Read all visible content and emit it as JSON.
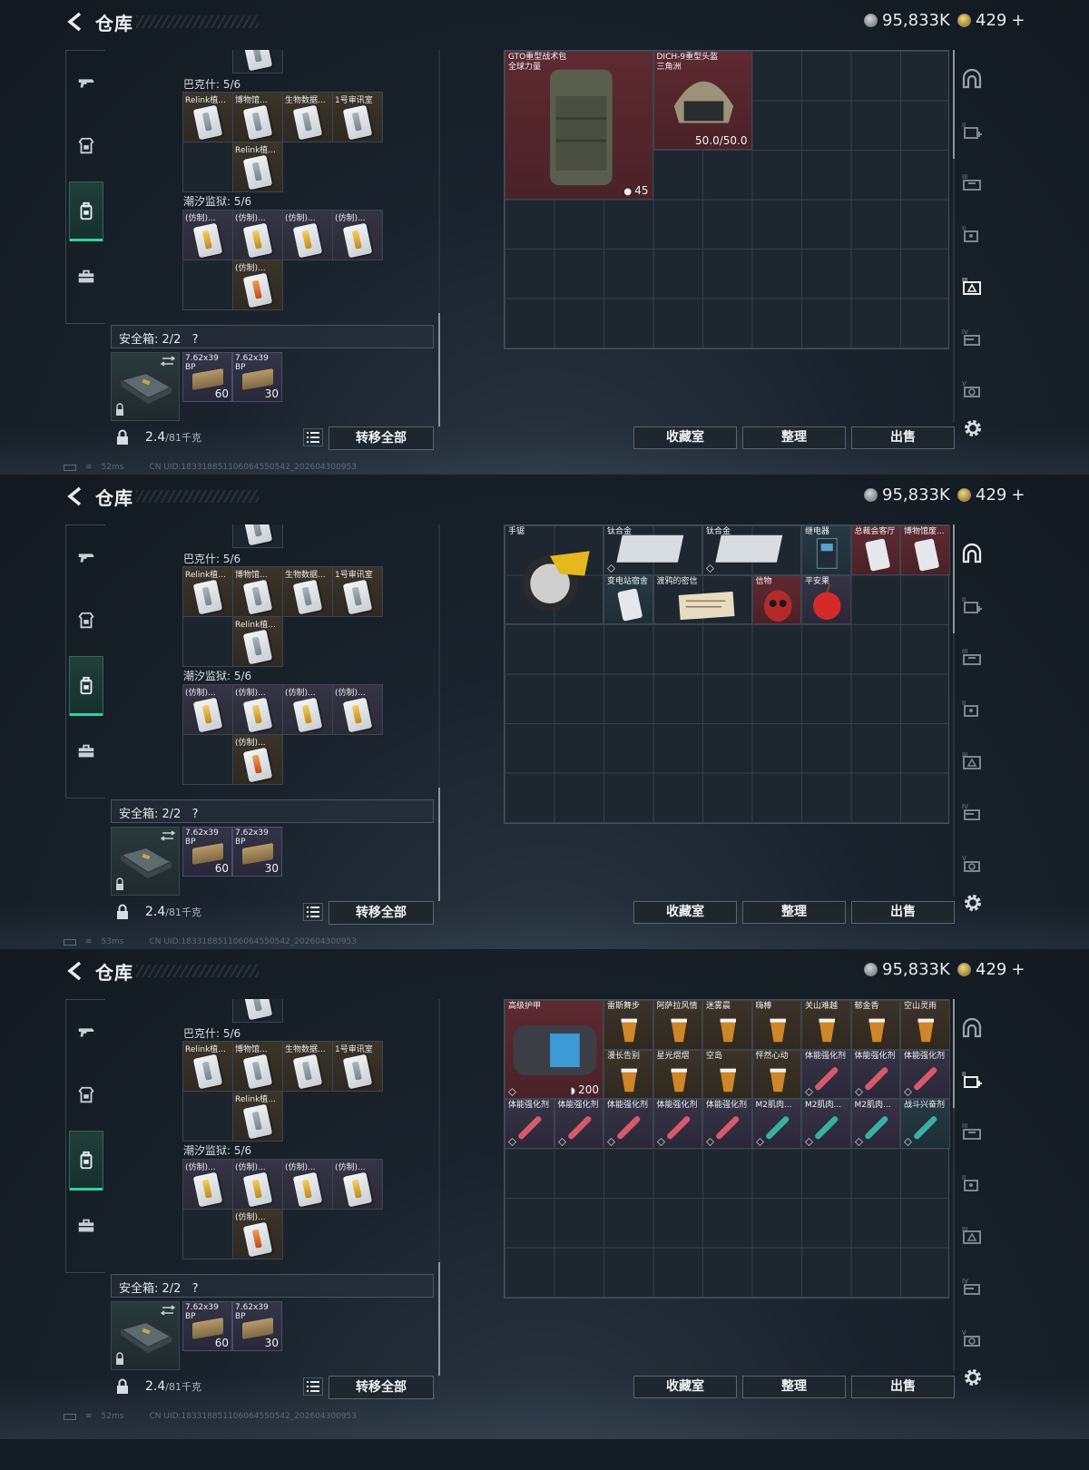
{
  "header": {
    "title": "仓库",
    "silver_amount": "95,833K",
    "gold_amount": "429",
    "plus": "+"
  },
  "left_nav": [
    "gun-icon",
    "armor-icon",
    "backpack-icon",
    "briefcase-icon"
  ],
  "containers": [
    {
      "label": "巴克什: 5/6",
      "items": [
        "Relink植...",
        "博物馆...",
        "生物数据...",
        "1号审讯室",
        "Relink植..."
      ]
    },
    {
      "label": "潮汐监狱: 5/6",
      "items": [
        "(仿制)...",
        "(仿制)...",
        "(仿制)...",
        "(仿制)...",
        "(仿制)..."
      ]
    }
  ],
  "safe_box": {
    "label": "安全箱: 2/2",
    "help": "?"
  },
  "ammo": [
    {
      "name": "7.62x39 BP",
      "count": "60"
    },
    {
      "name": "7.62x39 BP",
      "count": "30"
    }
  ],
  "weight": {
    "current": "2.4",
    "max": "/81千克"
  },
  "buttons": {
    "transfer_all": "转移全部",
    "collection": "收藏室",
    "organize": "整理",
    "sell": "出售"
  },
  "status": {
    "ping1": "52ms",
    "ping2": "53ms",
    "ping3": "52ms",
    "uid": "CN UID:1833188511060645505​42_202604300953"
  },
  "stash_pages": [
    {
      "items": [
        {
          "name": "GTO重型战术包",
          "sub": "全球力量",
          "value": "45"
        },
        {
          "name": "DICH-9重型头盔",
          "sub": "三角洲",
          "value": "50.0/50.0"
        }
      ]
    },
    {
      "items": [
        {
          "name": "手锯"
        },
        {
          "name": "钛合金"
        },
        {
          "name": "钛合金"
        },
        {
          "name": "继电器"
        },
        {
          "name": "总裁会客厅"
        },
        {
          "name": "博物馆废..."
        },
        {
          "name": "变电站宿舍"
        },
        {
          "name": "渡鸦的密信"
        },
        {
          "name": "信物"
        },
        {
          "name": "平安果"
        }
      ]
    },
    {
      "items": [
        {
          "name": "高级护甲",
          "value": "200"
        },
        {
          "name": "雷斯舞步"
        },
        {
          "name": "阿萨拉风情"
        },
        {
          "name": "迷雾晨"
        },
        {
          "name": "嗨棒"
        },
        {
          "name": "关山难越"
        },
        {
          "name": "郁金香"
        },
        {
          "name": "空山灵雨"
        },
        {
          "name": "漫长告别"
        },
        {
          "name": "星光熠熠"
        },
        {
          "name": "空岛"
        },
        {
          "name": "怦然心动"
        },
        {
          "name": "体能强化剂"
        },
        {
          "name": "体能强化剂"
        },
        {
          "name": "体能强化剂"
        },
        {
          "name": "体能强化剂"
        },
        {
          "name": "体能强化剂"
        },
        {
          "name": "体能强化剂"
        },
        {
          "name": "体能强化剂"
        },
        {
          "name": "体能强化剂"
        },
        {
          "name": "M2肌肉..."
        },
        {
          "name": "M2肌肉..."
        },
        {
          "name": "M2肌肉..."
        },
        {
          "name": "战斗兴奋剂"
        }
      ]
    }
  ]
}
